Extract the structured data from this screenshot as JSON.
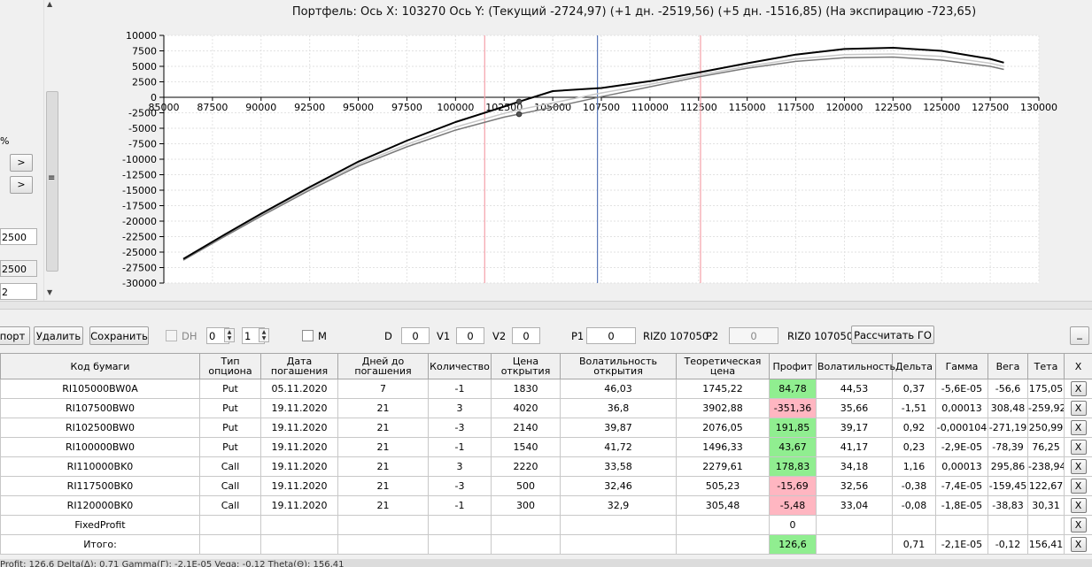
{
  "chart": {
    "title": "Портфель: Ось X: 103270 Ось Y:  (Текущий -2724,97)  (+1 дн. -2519,56)  (+5 дн. -1516,85)  (На экспирацию -723,65)"
  },
  "chart_data": {
    "type": "line",
    "xlim": [
      85000,
      130000
    ],
    "ylim": [
      -30000,
      10000
    ],
    "x_ticks": [
      "85000",
      "87500",
      "90000",
      "92500",
      "95000",
      "97500",
      "100000",
      "102500",
      "105000",
      "107500",
      "110000",
      "112500",
      "115000",
      "117500",
      "120000",
      "122500",
      "125000",
      "127500",
      "130000"
    ],
    "y_ticks": [
      "10000",
      "7500",
      "5000",
      "2500",
      "0",
      "-2500",
      "-5000",
      "-7500",
      "-10000",
      "-12500",
      "-15000",
      "-17500",
      "-20000",
      "-22500",
      "-25000",
      "-27500",
      "-30000"
    ],
    "grid": true,
    "vertical_lines": [
      {
        "x": 101500,
        "color": "#f4a0a8"
      },
      {
        "x": 107300,
        "color": "#5a78b8"
      },
      {
        "x": 112600,
        "color": "#f4a0a8"
      }
    ],
    "series": [
      {
        "color": "#000000",
        "x": [
          86000,
          88000,
          90000,
          92500,
          95000,
          97500,
          100000,
          102500,
          103270,
          105000,
          107500,
          110000,
          112500,
          115000,
          117500,
          120000,
          122500,
          125000,
          127500,
          128200
        ],
        "y": [
          -26100,
          -22400,
          -18800,
          -14500,
          -10400,
          -7000,
          -4000,
          -1500,
          -700,
          1000,
          1500,
          2600,
          4000,
          5500,
          6900,
          7800,
          8000,
          7500,
          6200,
          5600
        ]
      },
      {
        "color": "#7a7a7a",
        "x": [
          86000,
          88000,
          90000,
          92500,
          95000,
          97500,
          100000,
          102500,
          103270,
          105000,
          107500,
          110000,
          112500,
          115000,
          117500,
          120000,
          122500,
          125000,
          127500,
          128200
        ],
        "y": [
          -26300,
          -22700,
          -19200,
          -15000,
          -11100,
          -8000,
          -5300,
          -3200,
          -2720,
          -1600,
          100,
          1700,
          3300,
          4700,
          5800,
          6400,
          6500,
          6000,
          5000,
          4500
        ]
      },
      {
        "color": "#c8c8c8",
        "x": [
          86000,
          88000,
          90000,
          92500,
          95000,
          97500,
          100000,
          102500,
          103270,
          105000,
          107500,
          110000,
          112500,
          115000,
          117500,
          120000,
          122500,
          125000,
          127500,
          128200
        ],
        "y": [
          -26200,
          -22550,
          -19000,
          -14800,
          -10800,
          -7600,
          -4800,
          -2600,
          -2000,
          -900,
          700,
          2100,
          3600,
          5000,
          6200,
          6900,
          7000,
          6600,
          5500,
          5000
        ]
      }
    ],
    "markers": [
      {
        "x": 103270,
        "y": -700
      },
      {
        "x": 103270,
        "y": -2720
      }
    ]
  },
  "left_panel": {
    "percent_label": "%",
    "arrow1": ">",
    "arrow2": ">",
    "field1": "2500",
    "field2": "2500",
    "field3": "2",
    "scroll_icon": "≡"
  },
  "toolbar": {
    "import_label": "порт",
    "delete_label": "Удалить",
    "save_label": "Сохранить",
    "dh_label": "DH",
    "spin1": "0",
    "spin2": "1",
    "m_label": "M",
    "d_label": "D",
    "d_value": "0",
    "v1_label": "V1",
    "v1_value": "0",
    "v2_label": "V2",
    "v2_value": "0",
    "p1_label": "P1",
    "p1_value": "0",
    "riz_1": "RIZ0 107050",
    "p2_label": "P2",
    "p2_value": "0",
    "riz_2": "RIZ0 107050",
    "calc_label": "Рассчитать ГО",
    "minimize_label": "_"
  },
  "table": {
    "headers": [
      "Код бумаги",
      "Тип опциона",
      "Дата погашения",
      "Дней до погашения",
      "Количество",
      "Цена открытия",
      "Волатильность открытия",
      "Теоретическая цена",
      "Профит",
      "Волатильность",
      "Дельта",
      "Гамма",
      "Вега",
      "Тета",
      "X"
    ],
    "rows": [
      {
        "code": "RI105000BW0A",
        "type": "Put",
        "date": "05.11.2020",
        "days": "7",
        "qty": "-1",
        "open": "1830",
        "vol_open": "46,03",
        "theo": "1745,22",
        "profit": "84,78",
        "profit_color": "green",
        "vol": "44,53",
        "delta": "0,37",
        "gamma": "-5,6E-05",
        "vega": "-56,6",
        "theta": "175,05",
        "x": "X"
      },
      {
        "code": "RI107500BW0",
        "type": "Put",
        "date": "19.11.2020",
        "days": "21",
        "qty": "3",
        "open": "4020",
        "vol_open": "36,8",
        "theo": "3902,88",
        "profit": "-351,36",
        "profit_color": "red",
        "vol": "35,66",
        "delta": "-1,51",
        "gamma": "0,00013",
        "vega": "308,48",
        "theta": "-259,92",
        "x": "X"
      },
      {
        "code": "RI102500BW0",
        "type": "Put",
        "date": "19.11.2020",
        "days": "21",
        "qty": "-3",
        "open": "2140",
        "vol_open": "39,87",
        "theo": "2076,05",
        "profit": "191,85",
        "profit_color": "green",
        "vol": "39,17",
        "delta": "0,92",
        "gamma": "-0,000104",
        "vega": "-271,19",
        "theta": "250,99",
        "x": "X"
      },
      {
        "code": "RI100000BW0",
        "type": "Put",
        "date": "19.11.2020",
        "days": "21",
        "qty": "-1",
        "open": "1540",
        "vol_open": "41,72",
        "theo": "1496,33",
        "profit": "43,67",
        "profit_color": "green",
        "vol": "41,17",
        "delta": "0,23",
        "gamma": "-2,9E-05",
        "vega": "-78,39",
        "theta": "76,25",
        "x": "X"
      },
      {
        "code": "RI110000BK0",
        "type": "Call",
        "date": "19.11.2020",
        "days": "21",
        "qty": "3",
        "open": "2220",
        "vol_open": "33,58",
        "theo": "2279,61",
        "profit": "178,83",
        "profit_color": "green",
        "vol": "34,18",
        "delta": "1,16",
        "gamma": "0,00013",
        "vega": "295,86",
        "theta": "-238,94",
        "x": "X"
      },
      {
        "code": "RI117500BK0",
        "type": "Call",
        "date": "19.11.2020",
        "days": "21",
        "qty": "-3",
        "open": "500",
        "vol_open": "32,46",
        "theo": "505,23",
        "profit": "-15,69",
        "profit_color": "red",
        "vol": "32,56",
        "delta": "-0,38",
        "gamma": "-7,4E-05",
        "vega": "-159,45",
        "theta": "122,67",
        "x": "X"
      },
      {
        "code": "RI120000BK0",
        "type": "Call",
        "date": "19.11.2020",
        "days": "21",
        "qty": "-1",
        "open": "300",
        "vol_open": "32,9",
        "theo": "305,48",
        "profit": "-5,48",
        "profit_color": "red",
        "vol": "33,04",
        "delta": "-0,08",
        "gamma": "-1,8E-05",
        "vega": "-38,83",
        "theta": "30,31",
        "x": "X"
      }
    ],
    "fixed_profit": {
      "label": "FixedProfit",
      "profit": "0",
      "x": "X"
    },
    "total": {
      "label": "Итого:",
      "profit": "126,6",
      "delta": "0,71",
      "gamma": "-2,1E-05",
      "vega": "-0,12",
      "theta": "156,41",
      "x": "X"
    }
  },
  "status": {
    "text": "Profit: 126,6 Delta(∆): 0,71 Gamma(Γ): -2,1E-05 Vega: -0,12 Theta(Θ): 156,41"
  }
}
